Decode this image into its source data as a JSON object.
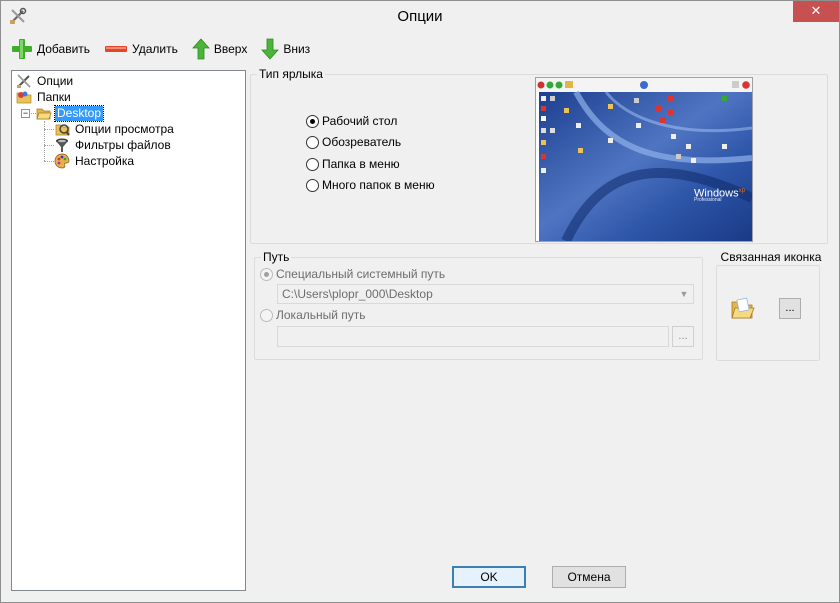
{
  "window": {
    "title": "Опции",
    "close_glyph": "✕"
  },
  "toolbar": {
    "add_label": "Добавить",
    "remove_label": "Удалить",
    "up_label": "Вверх",
    "down_label": "Вниз"
  },
  "tree": {
    "items": [
      {
        "label": "Опции",
        "icon": "tools-icon"
      },
      {
        "label": "Папки",
        "icon": "folders-icon"
      },
      {
        "label": "Desktop",
        "icon": "folder-open-icon",
        "selected": true
      },
      {
        "label": "Опции просмотра",
        "icon": "view-options-icon"
      },
      {
        "label": "Фильтры файлов",
        "icon": "filter-icon"
      },
      {
        "label": "Настройка",
        "icon": "palette-icon"
      }
    ],
    "expander_glyph": "−"
  },
  "shortcut_type": {
    "title": "Тип ярлыка",
    "options": [
      {
        "label": "Рабочий стол",
        "checked": true
      },
      {
        "label": "Обозреватель",
        "checked": false
      },
      {
        "label": "Папка в меню",
        "checked": false
      },
      {
        "label": "Много папок в меню",
        "checked": false
      }
    ]
  },
  "path": {
    "title": "Путь",
    "system_label": "Специальный системный путь",
    "system_value": "C:\\Users\\plopr_000\\Desktop",
    "local_label": "Локальный путь",
    "local_value": "",
    "browse_label": "..."
  },
  "icon_group": {
    "title": "Связанная иконка",
    "browse_label": "..."
  },
  "preview": {
    "logo_text": "Windows",
    "logo_xp": "xp",
    "logo_sub": "Professional"
  },
  "buttons": {
    "ok_label": "OK",
    "cancel_label": "Отмена"
  },
  "colors": {
    "selection": "#3399ff",
    "close": "#c75050",
    "xp_blue": "#2a4f9b"
  }
}
